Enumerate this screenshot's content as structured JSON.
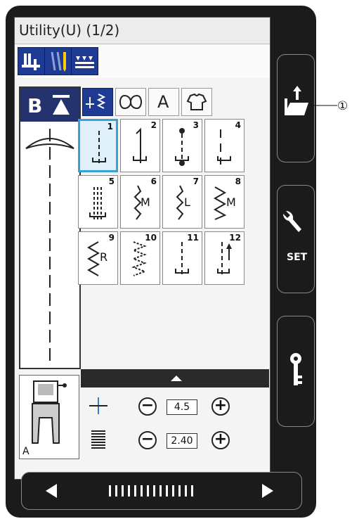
{
  "screen": {
    "title": "Utility(U) (1/2)",
    "foot_label": "A",
    "stitch_width_value": "4.5",
    "stitch_length_value": "2.40"
  },
  "b_indicator": "B",
  "side_buttons": {
    "set_label": "SET"
  },
  "callouts": {
    "load_callout": "①"
  },
  "stitches": [
    {
      "num": "1"
    },
    {
      "num": "2"
    },
    {
      "num": "3"
    },
    {
      "num": "4"
    },
    {
      "num": "5"
    },
    {
      "num": "6"
    },
    {
      "num": "7"
    },
    {
      "num": "8"
    },
    {
      "num": "9"
    },
    {
      "num": "10"
    },
    {
      "num": "11"
    },
    {
      "num": "12"
    }
  ],
  "stitch_letters": {
    "s6": "M",
    "s7": "L",
    "s8": "M",
    "s9": "R"
  },
  "tabs": {
    "letters_tab": "A"
  },
  "colors": {
    "accent_blue": "#1e3a93",
    "select_blue": "#3aa0d8",
    "device_bg": "#1b1b1b"
  }
}
